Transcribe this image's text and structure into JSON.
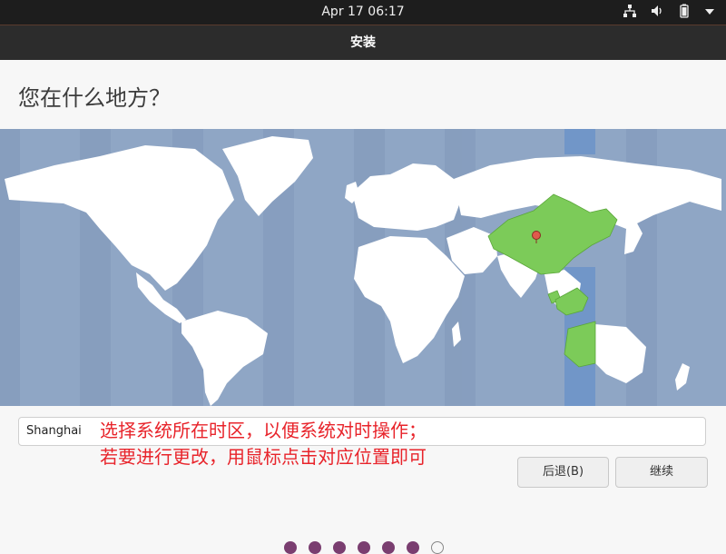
{
  "topbar": {
    "clock": "Apr 17  06:17",
    "icons": [
      "network-icon",
      "volume-icon",
      "battery-icon",
      "system-menu-arrow-icon"
    ]
  },
  "window": {
    "title": "安装"
  },
  "page": {
    "heading": "您在什么地方？"
  },
  "map": {
    "ocean_color": "#8fa6c5",
    "land_color": "#ffffff",
    "selected_region_color": "#7ccb59",
    "selected_band_color": "#7196c8",
    "marker_color": "#e05a4c"
  },
  "timezone": {
    "value": "Shanghai"
  },
  "annotation": {
    "line1": "选择系统所在时区，以便系统对时操作；",
    "line2": "若要进行更改，用鼠标点击对应位置即可",
    "color": "#e8242b"
  },
  "buttons": {
    "back": "后退(B)",
    "continue": "继续"
  },
  "progress": {
    "total": 7,
    "current": 6
  }
}
